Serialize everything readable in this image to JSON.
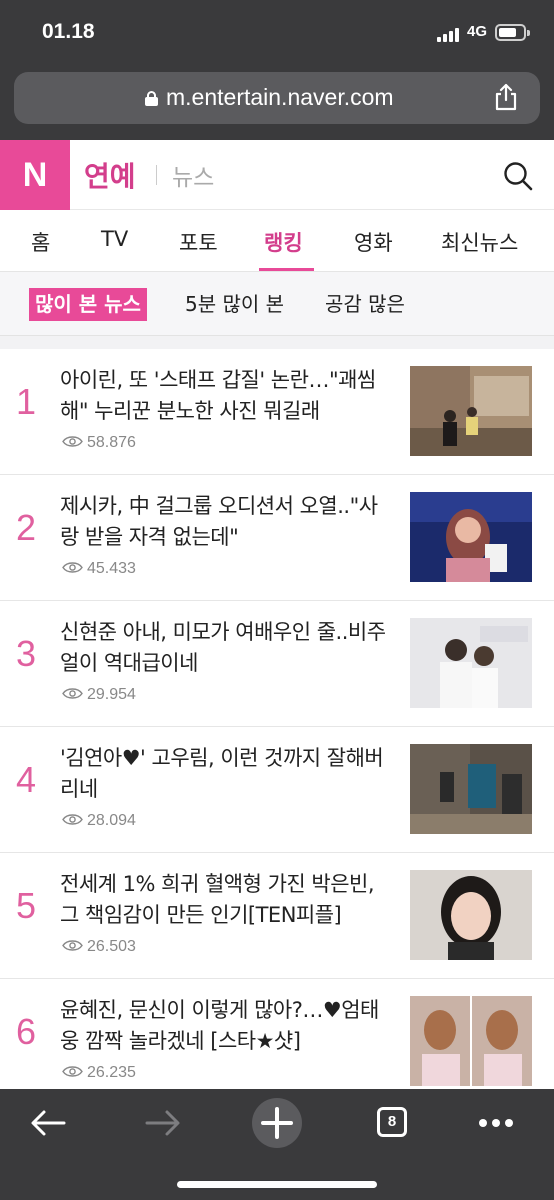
{
  "status_bar": {
    "time": "01.18",
    "network": "4G"
  },
  "browser": {
    "url": "m.entertain.naver.com",
    "tab_count": "8"
  },
  "header": {
    "logo": "N",
    "section": "연예",
    "subsection": "뉴스"
  },
  "tabs": [
    {
      "label": "홈"
    },
    {
      "label": "TV"
    },
    {
      "label": "포토"
    },
    {
      "label": "랭킹",
      "active": true
    },
    {
      "label": "영화"
    },
    {
      "label": "최신뉴스"
    }
  ],
  "filters": [
    {
      "label": "많이 본 뉴스",
      "active": true
    },
    {
      "label": "5분 많이 본"
    },
    {
      "label": "공감 많은"
    }
  ],
  "articles": [
    {
      "rank": "1",
      "title": "아이린, 또 '스태프 갑질' 논란…\"괘씸해\" 누리꾼 분노한 사진 뭐길래",
      "views": "58.876"
    },
    {
      "rank": "2",
      "title": "제시카, 中 걸그룹 오디션서 오열..\"사랑 받을 자격 없는데\"",
      "views": "45.433"
    },
    {
      "rank": "3",
      "title": "신현준 아내, 미모가 여배우인 줄..비주얼이 역대급이네",
      "views": "29.954"
    },
    {
      "rank": "4",
      "title": "'김연아♥' 고우림, 이런 것까지 잘해버리네",
      "views": "28.094"
    },
    {
      "rank": "5",
      "title": "전세계 1% 희귀 혈액형 가진 박은빈, 그 책임감이 만든 인기[TEN피플]",
      "views": "26.503"
    },
    {
      "rank": "6",
      "title": "윤혜진, 문신이 이렇게 많아?…♥엄태웅 깜짝 놀라겠네 [스타★샷]",
      "views": "26.235"
    }
  ],
  "colors": {
    "accent": "#e84a98",
    "rank": "#e0609f",
    "chrome": "#3a3a3c"
  }
}
